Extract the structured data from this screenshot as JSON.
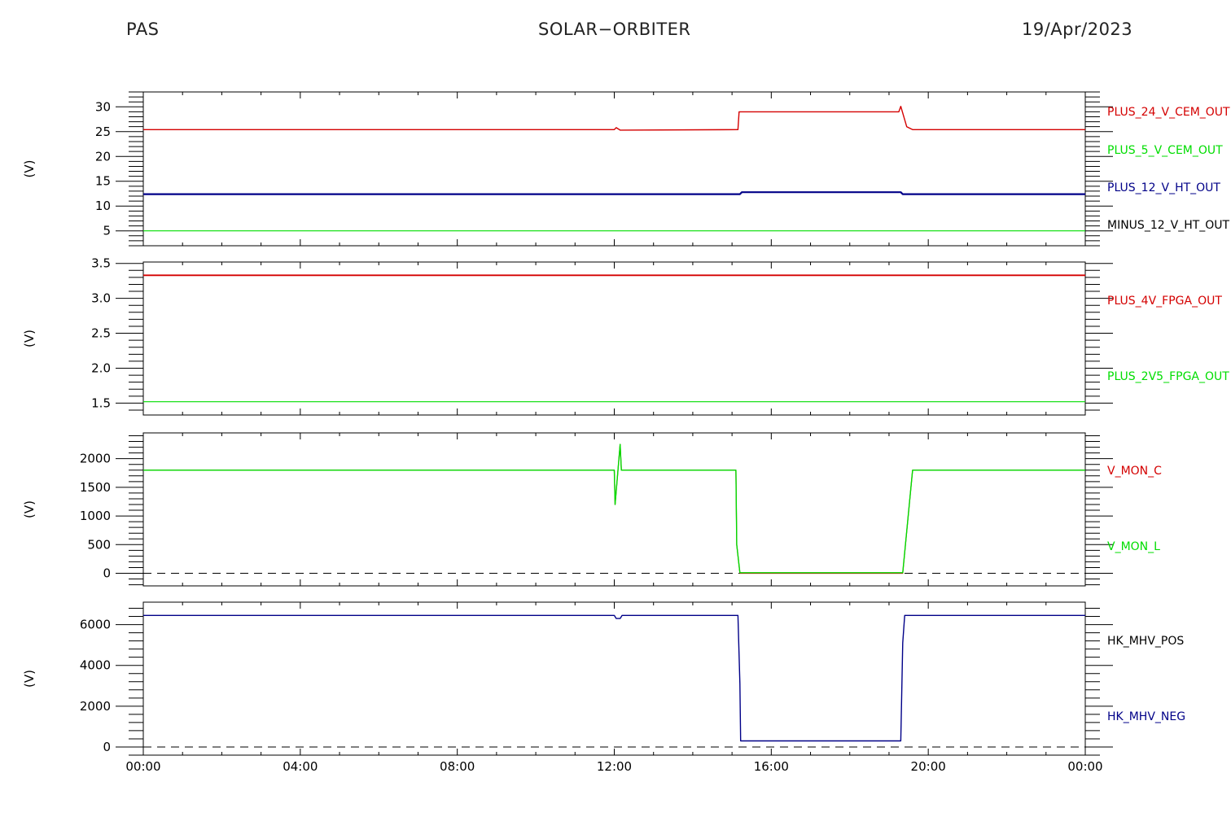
{
  "header": {
    "left": "PAS",
    "center": "SOLAR−ORBITER",
    "right": "19/Apr/2023"
  },
  "time_axis": {
    "ticks": [
      "00:00",
      "04:00",
      "08:00",
      "12:00",
      "16:00",
      "20:00",
      "00:00"
    ],
    "range_hours": [
      0,
      24
    ]
  },
  "chart_data": [
    {
      "type": "line",
      "ylabel": "(V)",
      "ylim": [
        2,
        33
      ],
      "yticks": [
        5,
        10,
        15,
        20,
        25,
        30
      ],
      "series": [
        {
          "name": "PLUS_24_V_CEM_OUT",
          "color": "#d40000",
          "width": 1.4,
          "points": [
            [
              0,
              25.4
            ],
            [
              12.0,
              25.4
            ],
            [
              12.05,
              25.8
            ],
            [
              12.15,
              25.3
            ],
            [
              15.15,
              25.4
            ],
            [
              15.18,
              29.0
            ],
            [
              19.25,
              29.0
            ],
            [
              19.3,
              30.1
            ],
            [
              19.45,
              26.0
            ],
            [
              19.6,
              25.4
            ],
            [
              24,
              25.4
            ]
          ]
        },
        {
          "name": "PLUS_5_V_CEM_OUT",
          "color": "#00dd00",
          "width": 1.2,
          "points": [
            [
              0,
              5.0
            ],
            [
              24,
              5.0
            ]
          ]
        },
        {
          "name": "PLUS_12_V_HT_OUT",
          "color": "#000088",
          "width": 2.2,
          "points": [
            [
              0,
              12.4
            ],
            [
              15.2,
              12.4
            ],
            [
              15.25,
              12.8
            ],
            [
              19.3,
              12.8
            ],
            [
              19.35,
              12.4
            ],
            [
              24,
              12.4
            ]
          ]
        },
        {
          "name": "MINUS_12_V_HT_OUT",
          "color": "#000000",
          "width": 1.2,
          "points": []
        }
      ]
    },
    {
      "type": "line",
      "ylabel": "(V)",
      "ylim": [
        1.33,
        3.52
      ],
      "yticks": [
        1.5,
        2.0,
        2.5,
        3.0,
        3.5
      ],
      "series": [
        {
          "name": "PLUS_4V_FPGA_OUT",
          "color": "#d40000",
          "width": 1.8,
          "points": [
            [
              0,
              3.33
            ],
            [
              24,
              3.33
            ]
          ]
        },
        {
          "name": "PLUS_2V5_FPGA_OUT",
          "color": "#00dd00",
          "width": 1.2,
          "points": [
            [
              0,
              1.52
            ],
            [
              24,
              1.52
            ]
          ]
        }
      ]
    },
    {
      "type": "line",
      "ylabel": "(V)",
      "ylim": [
        -220,
        2450
      ],
      "yticks": [
        0,
        500,
        1000,
        1500,
        2000
      ],
      "dashed_zero": true,
      "series": [
        {
          "name": "V_MON_C",
          "color": "#d40000",
          "width": 1.2,
          "points": [
            [
              0,
              1800
            ],
            [
              12.0,
              1800
            ],
            [
              12.02,
              1200
            ],
            [
              12.15,
              2250
            ],
            [
              12.18,
              1800
            ],
            [
              15.1,
              1800
            ],
            [
              15.12,
              500
            ],
            [
              15.2,
              0
            ],
            [
              19.35,
              0
            ],
            [
              19.6,
              1800
            ],
            [
              24,
              1800
            ]
          ]
        },
        {
          "name": "V_MON_L",
          "color": "#00dd00",
          "width": 1.4,
          "points": [
            [
              0,
              1800
            ],
            [
              12.0,
              1800
            ],
            [
              12.02,
              1200
            ],
            [
              12.15,
              2250
            ],
            [
              12.18,
              1800
            ],
            [
              15.1,
              1800
            ],
            [
              15.12,
              500
            ],
            [
              15.2,
              10
            ],
            [
              19.35,
              10
            ],
            [
              19.6,
              1800
            ],
            [
              24,
              1800
            ]
          ]
        }
      ]
    },
    {
      "type": "line",
      "ylabel": "(V)",
      "ylim": [
        -400,
        7100
      ],
      "yticks": [
        0,
        2000,
        4000,
        6000
      ],
      "dashed_zero": true,
      "series": [
        {
          "name": "HK_MHV_POS",
          "color": "#000000",
          "width": 1.2,
          "points": []
        },
        {
          "name": "HK_MHV_NEG",
          "color": "#000088",
          "width": 1.4,
          "points": [
            [
              0,
              6450
            ],
            [
              12.0,
              6450
            ],
            [
              12.05,
              6300
            ],
            [
              12.15,
              6300
            ],
            [
              12.2,
              6450
            ],
            [
              15.15,
              6450
            ],
            [
              15.2,
              3100
            ],
            [
              15.22,
              300
            ],
            [
              19.3,
              300
            ],
            [
              19.35,
              5100
            ],
            [
              19.4,
              6450
            ],
            [
              24,
              6450
            ]
          ]
        }
      ]
    }
  ]
}
